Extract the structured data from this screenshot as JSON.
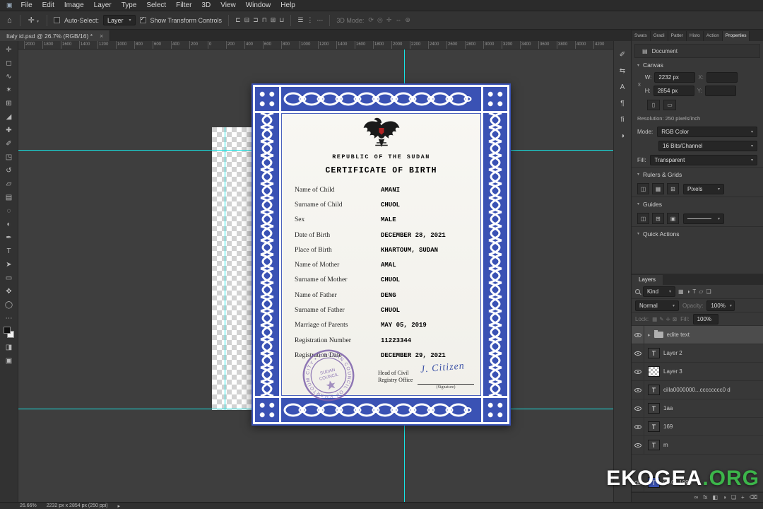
{
  "colors": {
    "accent_blue": "#3a52b4",
    "guide_cyan": "#17e4e4",
    "stamp_purple": "#7d61ab",
    "watermark_green": "#3cb54a",
    "signature_blue": "#3f55a8"
  },
  "menu_bar": {
    "items": [
      "File",
      "Edit",
      "Image",
      "Layer",
      "Type",
      "Select",
      "Filter",
      "3D",
      "View",
      "Window",
      "Help"
    ]
  },
  "options_bar": {
    "auto_select_label": "Auto-Select:",
    "auto_select_value": "Layer",
    "show_transform_label": "Show Transform Controls",
    "mode_3d_label": "3D Mode:",
    "align_icons": [
      {
        "name": "align-left-icon",
        "glyph": "⊏"
      },
      {
        "name": "align-center-h-icon",
        "glyph": "⊟"
      },
      {
        "name": "align-right-icon",
        "glyph": "⊐"
      },
      {
        "name": "align-top-icon",
        "glyph": "⊓"
      },
      {
        "name": "align-middle-icon",
        "glyph": "⊞"
      },
      {
        "name": "align-bottom-icon",
        "glyph": "⊔"
      }
    ],
    "distribute_icons": [
      {
        "name": "distribute-vertical-icon",
        "glyph": "☰"
      },
      {
        "name": "distribute-horizontal-icon",
        "glyph": "⋮"
      },
      {
        "name": "more-options-icon",
        "glyph": "⋯"
      }
    ],
    "mode3d_icons": [
      {
        "name": "3d-rotate-icon",
        "glyph": "⟳"
      },
      {
        "name": "3d-roll-icon",
        "glyph": "◎"
      },
      {
        "name": "3d-pan-icon",
        "glyph": "✛"
      },
      {
        "name": "3d-slide-icon",
        "glyph": "⇔"
      },
      {
        "name": "3d-scale-icon",
        "glyph": "⊕"
      }
    ]
  },
  "document_tab": {
    "title": "Italy id.psd @ 26.7% (RGB/16) *",
    "close": "×"
  },
  "ruler": {
    "labels": [
      "2000",
      "1800",
      "1600",
      "1400",
      "1200",
      "1000",
      "800",
      "600",
      "400",
      "200",
      "0",
      "200",
      "400",
      "600",
      "800",
      "1000",
      "1200",
      "1400",
      "1600",
      "1800",
      "2000",
      "2200",
      "2400",
      "2600",
      "2800",
      "3000",
      "3200",
      "3400",
      "3600",
      "3800",
      "4000",
      "4200"
    ]
  },
  "tools": [
    {
      "name": "move-tool",
      "glyph": "✛"
    },
    {
      "name": "marquee-tool",
      "glyph": "◻"
    },
    {
      "name": "lasso-tool",
      "glyph": "∿"
    },
    {
      "name": "quick-selection-tool",
      "glyph": "✶"
    },
    {
      "name": "crop-tool",
      "glyph": "⊞"
    },
    {
      "name": "eyedropper-tool",
      "glyph": "◢"
    },
    {
      "name": "healing-brush-tool",
      "glyph": "✚"
    },
    {
      "name": "brush-tool",
      "glyph": "✐"
    },
    {
      "name": "clone-stamp-tool",
      "glyph": "◳"
    },
    {
      "name": "history-brush-tool",
      "glyph": "↺"
    },
    {
      "name": "eraser-tool",
      "glyph": "▱"
    },
    {
      "name": "gradient-tool",
      "glyph": "▤"
    },
    {
      "name": "blur-tool",
      "glyph": "◌"
    },
    {
      "name": "dodge-tool",
      "glyph": "◐"
    },
    {
      "name": "pen-tool",
      "glyph": "✒"
    },
    {
      "name": "type-tool",
      "glyph": "T"
    },
    {
      "name": "path-selection-tool",
      "glyph": "➤"
    },
    {
      "name": "shape-tool",
      "glyph": "▭"
    },
    {
      "name": "hand-tool",
      "glyph": "✥"
    },
    {
      "name": "zoom-tool",
      "glyph": "◯"
    },
    {
      "name": "edit-toolbar-icon",
      "glyph": "⋯"
    },
    {
      "name": "color-swatches",
      "glyph": ""
    },
    {
      "name": "quick-mask-icon",
      "glyph": "◨"
    },
    {
      "name": "screen-mode-icon",
      "glyph": "▣"
    }
  ],
  "side_strip": [
    {
      "name": "collapse-panels-icon",
      "glyph": "«"
    },
    {
      "name": "brushes-panel-icon",
      "glyph": "✐"
    },
    {
      "name": "clone-source-panel-icon",
      "glyph": "⇆"
    },
    {
      "name": "character-panel-icon",
      "glyph": "A"
    },
    {
      "name": "paragraph-panel-icon",
      "glyph": "¶"
    },
    {
      "name": "glyphs-panel-icon",
      "glyph": "fi"
    },
    {
      "name": "adjustments-panel-icon",
      "glyph": "◑"
    }
  ],
  "panel_tabs": [
    {
      "label": "Swats",
      "active": false
    },
    {
      "label": "Gradi",
      "active": false
    },
    {
      "label": "Patter",
      "active": false
    },
    {
      "label": "Histo",
      "active": false
    },
    {
      "label": "Action",
      "active": false
    },
    {
      "label": "Properties",
      "active": true
    }
  ],
  "properties_panel": {
    "document_label": "Document",
    "canvas_header": "Canvas",
    "w_label": "W:",
    "w_value": "2232 px",
    "x_label": "X:",
    "h_label": "H:",
    "h_value": "2854 px",
    "y_label": "Y:",
    "resolution_label": "Resolution: 250 pixels/inch",
    "mode_label": "Mode:",
    "mode_value": "RGB Color",
    "depth_value": "16 Bits/Channel",
    "fill_label": "Fill:",
    "fill_value": "Transparent",
    "rulers_header": "Rulers & Grids",
    "rulers_icons": [
      {
        "name": "ruler-toggle-icon",
        "glyph": "◫"
      },
      {
        "name": "grid-toggle-icon",
        "glyph": "▦"
      },
      {
        "name": "snap-toggle-icon",
        "glyph": "⊞"
      }
    ],
    "grid_unit_value": "Pixels",
    "guides_header": "Guides",
    "guides_icons": [
      {
        "name": "new-guide-icon",
        "glyph": "◫"
      },
      {
        "name": "guide-layout-icon",
        "glyph": "⊞"
      },
      {
        "name": "lock-guides-icon",
        "glyph": "▣"
      }
    ],
    "quick_actions_header": "Quick Actions"
  },
  "layers_panel": {
    "tab_label": "Layers",
    "search_kind": "Kind",
    "filter_icons": [
      {
        "name": "filter-pixel-icon",
        "glyph": "▦"
      },
      {
        "name": "filter-adjustment-icon",
        "glyph": "◑"
      },
      {
        "name": "filter-type-icon",
        "glyph": "T"
      },
      {
        "name": "filter-shape-icon",
        "glyph": "▱"
      },
      {
        "name": "filter-smart-icon",
        "glyph": "❏"
      }
    ],
    "blend_mode": "Normal",
    "opacity_label": "Opacity:",
    "opacity_value": "100%",
    "lock_label": "Lock:",
    "lock_icons": [
      {
        "name": "lock-transparency-icon",
        "glyph": "▦"
      },
      {
        "name": "lock-paint-icon",
        "glyph": "✎"
      },
      {
        "name": "lock-move-icon",
        "glyph": "✛"
      },
      {
        "name": "lock-all-icon",
        "glyph": "⊠"
      }
    ],
    "fill_label": "Fill:",
    "fill_value": "100%",
    "rows": [
      {
        "name": "edite text",
        "type": "group",
        "selected": true
      },
      {
        "name": "Layer 2",
        "type": "text"
      },
      {
        "name": "Layer 3",
        "type": "pixel"
      },
      {
        "name": "cilla0000000...cccccccc0 d",
        "type": "text"
      },
      {
        "name": "1aa",
        "type": "text"
      },
      {
        "name": "169",
        "type": "text"
      },
      {
        "name": "m",
        "type": "text"
      },
      {
        "name": "01.01.1990",
        "type": "text",
        "blue": true,
        "gap_before": true
      }
    ],
    "footer_icons": [
      {
        "name": "link-layers-icon",
        "glyph": "∞"
      },
      {
        "name": "layer-effects-icon",
        "glyph": "fx"
      },
      {
        "name": "layer-mask-icon",
        "glyph": "◧"
      },
      {
        "name": "adjustment-layer-icon",
        "glyph": "◑"
      },
      {
        "name": "layer-group-icon",
        "glyph": "❏"
      },
      {
        "name": "new-layer-icon",
        "glyph": "+"
      },
      {
        "name": "delete-layer-icon",
        "glyph": "⌫"
      }
    ]
  },
  "certificate": {
    "country": "REPUBLIC OF THE SUDAN",
    "title": "CERTIFICATE OF BIRTH",
    "fields": [
      {
        "label": "Name of Child",
        "value": "AMANI"
      },
      {
        "label": "Surname of Child",
        "value": "CHUOL"
      },
      {
        "label": "Sex",
        "value": "MALE"
      },
      {
        "label": "Date of Birth",
        "value": "DECEMBER 28, 2021"
      },
      {
        "label": "Place of Birth",
        "value": "KHARTOUM, SUDAN"
      },
      {
        "label": "Name of Mother",
        "value": "AMAL"
      },
      {
        "label": "Surname of Mother",
        "value": "CHUOL"
      },
      {
        "label": "Name of Father",
        "value": "DENG"
      },
      {
        "label": "Surname of Father",
        "value": "CHUOL"
      },
      {
        "label": "Marriage of Parents",
        "value": "MAY 05, 2019"
      },
      {
        "label": "Registration Number",
        "value": "11223344"
      },
      {
        "label": "Registration Date",
        "value": "DECEMBER 29, 2021"
      }
    ],
    "office_line1": "Head of Civil",
    "office_line2": "Registry Office",
    "signature": "J. Citizen",
    "signature_caption": "(Signature)",
    "stamp": {
      "ring_text": "SUDAN COUNCIL OF KHARTOUM CITY • REGISTRY •",
      "center_line1": "SUDAN",
      "center_line2": "COUNCIL"
    }
  },
  "watermark": {
    "text_white": "EKOGEA",
    "text_green": ".ORG"
  },
  "status_bar": {
    "zoom": "26.66%",
    "doc_info": "2232 px x 2854 px (250 ppi)"
  }
}
